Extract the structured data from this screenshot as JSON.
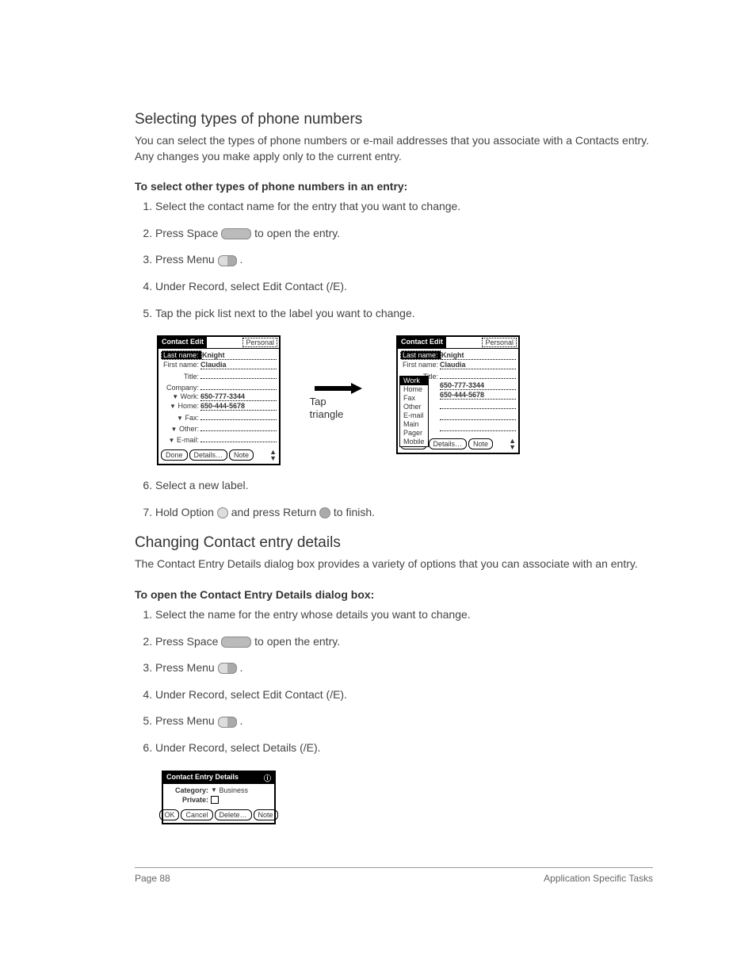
{
  "section1": {
    "heading": "Selecting types of phone numbers",
    "para": "You can select the types of phone numbers or e-mail addresses that you associate with a Contacts entry. Any changes you make apply only to the current entry.",
    "subhead": "To select other types of phone numbers in an entry:",
    "steps": {
      "s1": "Select the contact name for the entry that you want to change.",
      "s2a": "Press Space ",
      "s2b": " to open the entry.",
      "s3a": "Press Menu ",
      "s3b": " .",
      "s4": "Under Record, select Edit Contact (/E).",
      "s5": "Tap the pick list next to the label you want to change.",
      "s6": "Select a new label.",
      "s7a": "Hold Option ",
      "s7b": " and press Return ",
      "s7c": " to finish."
    }
  },
  "fig": {
    "caption1": "Tap",
    "caption2": "triangle",
    "pda1": {
      "title": "Contact Edit",
      "cat": "Personal",
      "lastname_l": "Last name:",
      "lastname_v": "Knight",
      "firstname_l": "First name:",
      "firstname_v": "Claudia",
      "title_l": "Title:",
      "company_l": "Company:",
      "work_l": "Work:",
      "work_v": "650-777-3344",
      "home_l": "Home:",
      "home_v": "650-444-5678",
      "fax_l": "Fax:",
      "other_l": "Other:",
      "email_l": "E-mail:",
      "btn_done": "Done",
      "btn_details": "Details…",
      "btn_note": "Note"
    },
    "picklist": {
      "i1": "Work",
      "i2": "Home",
      "i3": "Fax",
      "i4": "Other",
      "i5": "E-mail",
      "i6": "Main",
      "i7": "Pager",
      "i8": "Mobile"
    }
  },
  "section2": {
    "heading": "Changing Contact entry details",
    "para": "The Contact Entry Details dialog box provides a variety of options that you can associate with an entry.",
    "subhead": "To open the Contact Entry Details dialog box:",
    "steps": {
      "s1": "Select the name for the entry whose details you want to change.",
      "s2a": "Press Space ",
      "s2b": " to open the entry.",
      "s3a": "Press Menu ",
      "s3b": " .",
      "s4": "Under Record, select Edit Contact (/E).",
      "s5a": "Press Menu ",
      "s5b": " .",
      "s6": "Under Record, select Details (/E)."
    }
  },
  "details": {
    "title": "Contact Entry Details",
    "icon": "ⓘ",
    "cat_l": "Category:",
    "cat_v": "Business",
    "priv_l": "Private:",
    "btn_ok": "OK",
    "btn_cancel": "Cancel",
    "btn_delete": "Delete…",
    "btn_note": "Note"
  },
  "footer": {
    "left": "Page 88",
    "right": "Application Specific Tasks"
  }
}
